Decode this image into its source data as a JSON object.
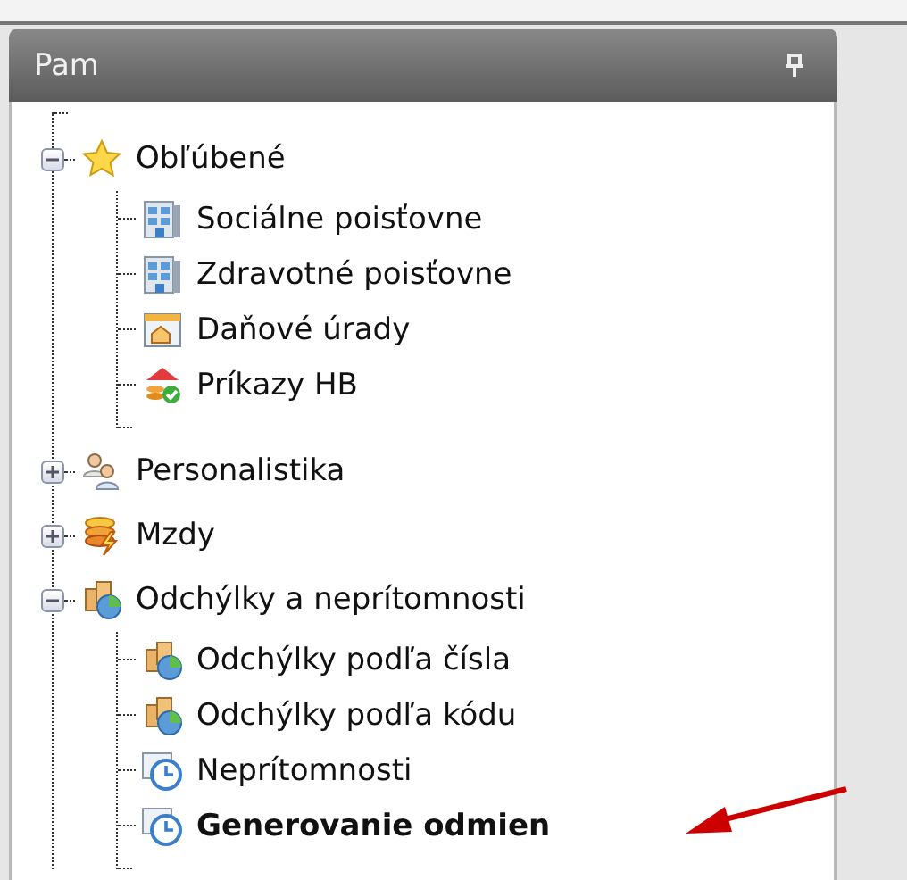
{
  "panel": {
    "title": "Pam"
  },
  "tree": [
    {
      "label": "Obľúbené",
      "kind": "star",
      "expanded": true,
      "selected": false,
      "children": [
        {
          "label": "Sociálne poisťovne",
          "kind": "building",
          "selected": false
        },
        {
          "label": "Zdravotné poisťovne",
          "kind": "building",
          "selected": false
        },
        {
          "label": "Daňové úrady",
          "kind": "house",
          "selected": false
        },
        {
          "label": "Príkazy HB",
          "kind": "coins-check",
          "selected": false
        }
      ]
    },
    {
      "label": "Personalistika",
      "kind": "people",
      "expanded": false,
      "selected": false
    },
    {
      "label": "Mzdy",
      "kind": "coins-lightning",
      "expanded": false,
      "selected": false
    },
    {
      "label": "Odchýlky a neprítomnosti",
      "kind": "coins-chart",
      "expanded": true,
      "selected": false,
      "children": [
        {
          "label": "Odchýlky podľa čísla",
          "kind": "coins-chart",
          "selected": false
        },
        {
          "label": "Odchýlky podľa kódu",
          "kind": "coins-chart",
          "selected": false
        },
        {
          "label": "Neprítomnosti",
          "kind": "calendar-clock",
          "selected": false
        },
        {
          "label": "Generovanie odmien",
          "kind": "calendar-clock",
          "selected": true
        }
      ]
    }
  ]
}
